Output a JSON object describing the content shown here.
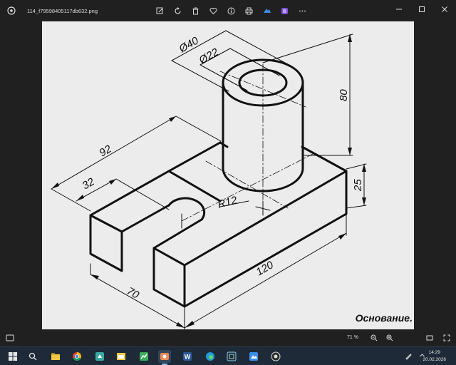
{
  "titlebar": {
    "file_name": "114_f79598405117db632.png"
  },
  "toolbar": {
    "icons": [
      "edit-icon",
      "rotate-icon",
      "delete-icon",
      "favorite-icon",
      "info-icon",
      "print-icon",
      "share-icon",
      "more-app-icon",
      "more-icon"
    ]
  },
  "window_controls": [
    "minimize",
    "maximize",
    "close"
  ],
  "drawing": {
    "dim_d40": "Ø40",
    "dim_d22": "Ø22",
    "dim_80": "80",
    "dim_92": "92",
    "dim_32": "32",
    "dim_r12": "R12",
    "dim_25": "25",
    "dim_120": "120",
    "dim_70": "70",
    "caption": "Основание."
  },
  "statusbar": {
    "zoom": "71 %"
  },
  "taskbar": {
    "time": "14:29",
    "date": "20.02.2026"
  }
}
